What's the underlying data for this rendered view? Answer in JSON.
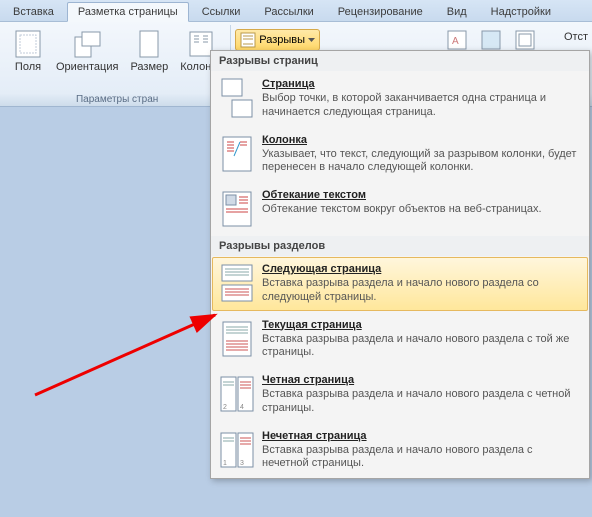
{
  "tabs": {
    "insert": "Вставка",
    "pageLayout": "Разметка страницы",
    "references": "Ссылки",
    "mailings": "Рассылки",
    "review": "Рецензирование",
    "view": "Вид",
    "addins": "Надстройки"
  },
  "ribbon": {
    "margins": "Поля",
    "orientation": "Ориентация",
    "size": "Размер",
    "columns": "Колонки",
    "breaks": "Разрывы",
    "groupCaption": "Параметры стран",
    "indent": "Отст"
  },
  "dropdown": {
    "section1": "Разрывы страниц",
    "page_t": "Страница",
    "page_d": "Выбор точки, в которой заканчивается одна страница и начинается следующая страница.",
    "column_t": "Колонка",
    "column_d": "Указывает, что текст, следующий за разрывом колонки, будет перенесен в начало следующей колонки.",
    "wrap_t": "Обтекание текстом",
    "wrap_d": "Обтекание текстом вокруг объектов на веб-страницах.",
    "section2": "Разрывы разделов",
    "next_t": "Следующая страница",
    "next_d": "Вставка разрыва раздела и начало нового раздела со следующей страницы.",
    "cont_t": "Текущая страница",
    "cont_d": "Вставка разрыва раздела и начало нового раздела с той же страницы.",
    "even_t": "Четная страница",
    "even_d": "Вставка разрыва раздела и начало нового раздела с четной страницы.",
    "odd_t": "Нечетная страница",
    "odd_d": "Вставка разрыва раздела и начало нового раздела с нечетной страницы."
  }
}
